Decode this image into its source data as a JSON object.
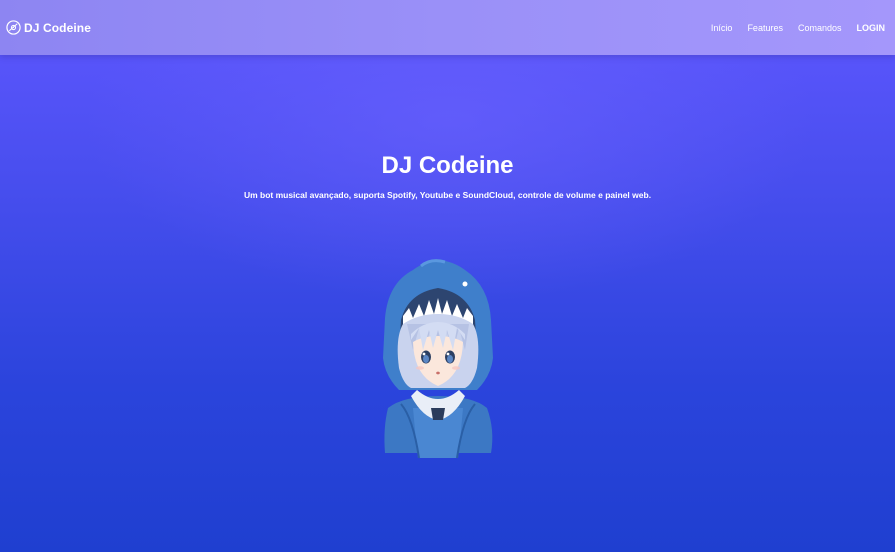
{
  "navbar": {
    "brand_icon": "vinyl-disc-icon",
    "brand_name": "DJ Codeine",
    "links": [
      {
        "label": "Início"
      },
      {
        "label": "Features"
      },
      {
        "label": "Comandos"
      }
    ],
    "login_label": "LOGIN"
  },
  "hero": {
    "title": "DJ Codeine",
    "subtitle": "Um bot musical avançado, suporta Spotify, Youtube e SoundCloud, controle de volume e painel web.",
    "image": "anime-shark-hood-girl-illustration"
  },
  "colors": {
    "navbar": "#9a90f8",
    "background_top": "#5f57ff",
    "background_bottom": "#1f3fd0",
    "text": "#ffffff"
  }
}
